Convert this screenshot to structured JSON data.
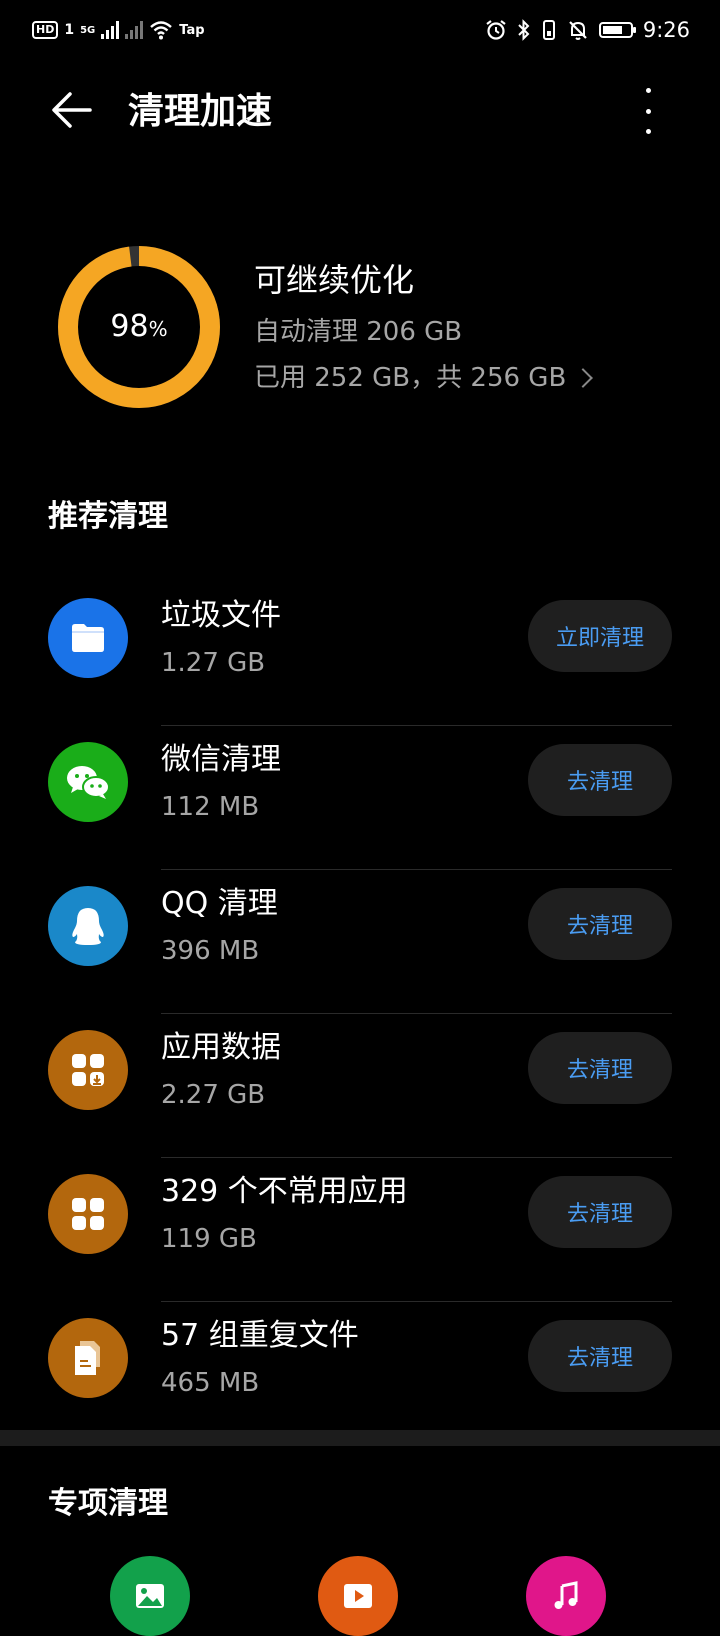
{
  "status_bar": {
    "time": "9:26",
    "hd_label": "HD",
    "sim_label": "1",
    "network_label": "5G",
    "wifi_label": "Tap",
    "battery_level_percent": 75
  },
  "header": {
    "title": "清理加速"
  },
  "storage": {
    "ring_value": "98",
    "ring_unit": "%",
    "ring_fraction": 0.98,
    "status": "可继续优化",
    "auto_clean": "自动清理 206 GB",
    "usage": "已用 252 GB，共 256 GB",
    "ring_color": "#f5a623"
  },
  "recommended": {
    "title": "推荐清理",
    "items": [
      {
        "name": "垃圾文件",
        "size": "1.27 GB",
        "button": "立即清理",
        "icon": "folder-icon",
        "icon_color": "#1a73e8"
      },
      {
        "name": "微信清理",
        "size": "112 MB",
        "button": "去清理",
        "icon": "wechat-icon",
        "icon_color": "#1aad19"
      },
      {
        "name": "QQ 清理",
        "size": "396 MB",
        "button": "去清理",
        "icon": "qq-penguin-icon",
        "icon_color": "#1a88c9"
      },
      {
        "name": "应用数据",
        "size": "2.27 GB",
        "button": "去清理",
        "icon": "app-data-icon",
        "icon_color": "#b3670d"
      },
      {
        "name": "329 个不常用应用",
        "size": "119 GB",
        "button": "去清理",
        "icon": "apps-grid-icon",
        "icon_color": "#b3670d"
      },
      {
        "name": "57 组重复文件",
        "size": "465 MB",
        "button": "去清理",
        "icon": "duplicate-files-icon",
        "icon_color": "#b3670d"
      }
    ]
  },
  "special": {
    "title": "专项清理",
    "icons": [
      {
        "icon": "image-icon",
        "color": "#12a14b"
      },
      {
        "icon": "video-icon",
        "color": "#e05a12"
      },
      {
        "icon": "music-icon",
        "color": "#e0168a"
      }
    ]
  }
}
